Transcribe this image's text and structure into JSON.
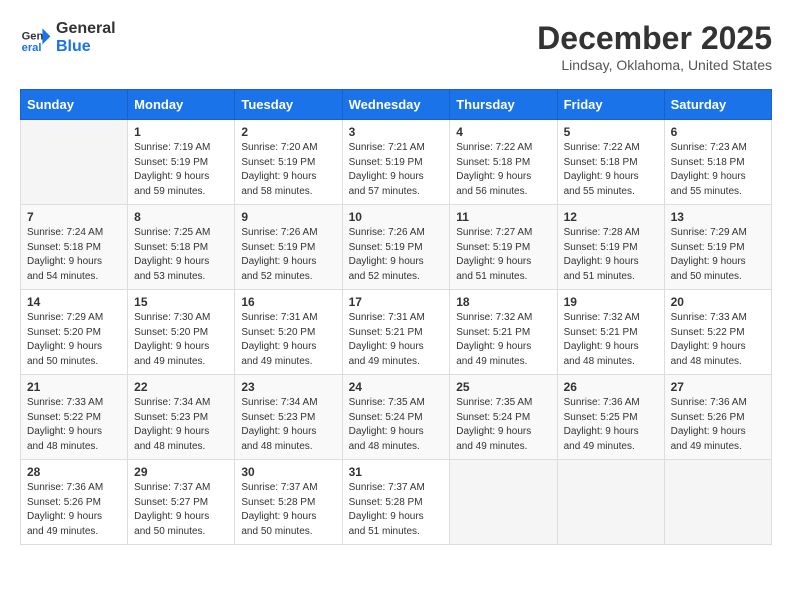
{
  "header": {
    "logo_line1": "General",
    "logo_line2": "Blue",
    "month": "December 2025",
    "location": "Lindsay, Oklahoma, United States"
  },
  "weekdays": [
    "Sunday",
    "Monday",
    "Tuesday",
    "Wednesday",
    "Thursday",
    "Friday",
    "Saturday"
  ],
  "weeks": [
    [
      {
        "day": "",
        "info": ""
      },
      {
        "day": "1",
        "info": "Sunrise: 7:19 AM\nSunset: 5:19 PM\nDaylight: 9 hours\nand 59 minutes."
      },
      {
        "day": "2",
        "info": "Sunrise: 7:20 AM\nSunset: 5:19 PM\nDaylight: 9 hours\nand 58 minutes."
      },
      {
        "day": "3",
        "info": "Sunrise: 7:21 AM\nSunset: 5:19 PM\nDaylight: 9 hours\nand 57 minutes."
      },
      {
        "day": "4",
        "info": "Sunrise: 7:22 AM\nSunset: 5:18 PM\nDaylight: 9 hours\nand 56 minutes."
      },
      {
        "day": "5",
        "info": "Sunrise: 7:22 AM\nSunset: 5:18 PM\nDaylight: 9 hours\nand 55 minutes."
      },
      {
        "day": "6",
        "info": "Sunrise: 7:23 AM\nSunset: 5:18 PM\nDaylight: 9 hours\nand 55 minutes."
      }
    ],
    [
      {
        "day": "7",
        "info": "Sunrise: 7:24 AM\nSunset: 5:18 PM\nDaylight: 9 hours\nand 54 minutes."
      },
      {
        "day": "8",
        "info": "Sunrise: 7:25 AM\nSunset: 5:18 PM\nDaylight: 9 hours\nand 53 minutes."
      },
      {
        "day": "9",
        "info": "Sunrise: 7:26 AM\nSunset: 5:19 PM\nDaylight: 9 hours\nand 52 minutes."
      },
      {
        "day": "10",
        "info": "Sunrise: 7:26 AM\nSunset: 5:19 PM\nDaylight: 9 hours\nand 52 minutes."
      },
      {
        "day": "11",
        "info": "Sunrise: 7:27 AM\nSunset: 5:19 PM\nDaylight: 9 hours\nand 51 minutes."
      },
      {
        "day": "12",
        "info": "Sunrise: 7:28 AM\nSunset: 5:19 PM\nDaylight: 9 hours\nand 51 minutes."
      },
      {
        "day": "13",
        "info": "Sunrise: 7:29 AM\nSunset: 5:19 PM\nDaylight: 9 hours\nand 50 minutes."
      }
    ],
    [
      {
        "day": "14",
        "info": "Sunrise: 7:29 AM\nSunset: 5:20 PM\nDaylight: 9 hours\nand 50 minutes."
      },
      {
        "day": "15",
        "info": "Sunrise: 7:30 AM\nSunset: 5:20 PM\nDaylight: 9 hours\nand 49 minutes."
      },
      {
        "day": "16",
        "info": "Sunrise: 7:31 AM\nSunset: 5:20 PM\nDaylight: 9 hours\nand 49 minutes."
      },
      {
        "day": "17",
        "info": "Sunrise: 7:31 AM\nSunset: 5:21 PM\nDaylight: 9 hours\nand 49 minutes."
      },
      {
        "day": "18",
        "info": "Sunrise: 7:32 AM\nSunset: 5:21 PM\nDaylight: 9 hours\nand 49 minutes."
      },
      {
        "day": "19",
        "info": "Sunrise: 7:32 AM\nSunset: 5:21 PM\nDaylight: 9 hours\nand 48 minutes."
      },
      {
        "day": "20",
        "info": "Sunrise: 7:33 AM\nSunset: 5:22 PM\nDaylight: 9 hours\nand 48 minutes."
      }
    ],
    [
      {
        "day": "21",
        "info": "Sunrise: 7:33 AM\nSunset: 5:22 PM\nDaylight: 9 hours\nand 48 minutes."
      },
      {
        "day": "22",
        "info": "Sunrise: 7:34 AM\nSunset: 5:23 PM\nDaylight: 9 hours\nand 48 minutes."
      },
      {
        "day": "23",
        "info": "Sunrise: 7:34 AM\nSunset: 5:23 PM\nDaylight: 9 hours\nand 48 minutes."
      },
      {
        "day": "24",
        "info": "Sunrise: 7:35 AM\nSunset: 5:24 PM\nDaylight: 9 hours\nand 48 minutes."
      },
      {
        "day": "25",
        "info": "Sunrise: 7:35 AM\nSunset: 5:24 PM\nDaylight: 9 hours\nand 49 minutes."
      },
      {
        "day": "26",
        "info": "Sunrise: 7:36 AM\nSunset: 5:25 PM\nDaylight: 9 hours\nand 49 minutes."
      },
      {
        "day": "27",
        "info": "Sunrise: 7:36 AM\nSunset: 5:26 PM\nDaylight: 9 hours\nand 49 minutes."
      }
    ],
    [
      {
        "day": "28",
        "info": "Sunrise: 7:36 AM\nSunset: 5:26 PM\nDaylight: 9 hours\nand 49 minutes."
      },
      {
        "day": "29",
        "info": "Sunrise: 7:37 AM\nSunset: 5:27 PM\nDaylight: 9 hours\nand 50 minutes."
      },
      {
        "day": "30",
        "info": "Sunrise: 7:37 AM\nSunset: 5:28 PM\nDaylight: 9 hours\nand 50 minutes."
      },
      {
        "day": "31",
        "info": "Sunrise: 7:37 AM\nSunset: 5:28 PM\nDaylight: 9 hours\nand 51 minutes."
      },
      {
        "day": "",
        "info": ""
      },
      {
        "day": "",
        "info": ""
      },
      {
        "day": "",
        "info": ""
      }
    ]
  ]
}
